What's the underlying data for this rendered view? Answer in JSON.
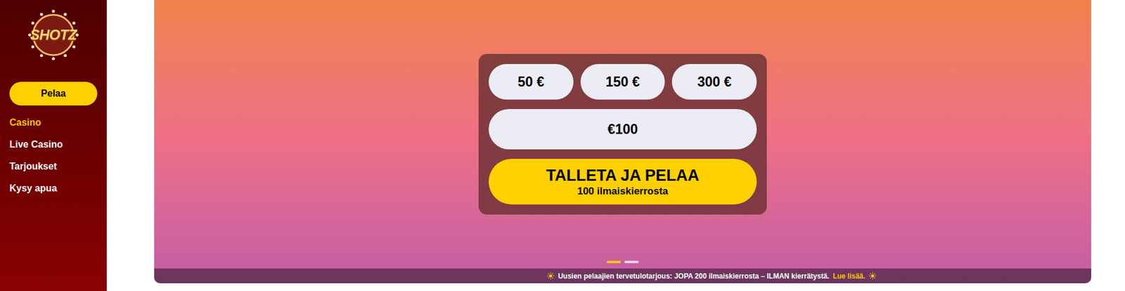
{
  "logo": {
    "text": "SHOTZ"
  },
  "sidebar": {
    "play_button": "Pelaa",
    "items": [
      {
        "label": "Casino",
        "selected": true
      },
      {
        "label": "Live Casino",
        "selected": false
      },
      {
        "label": "Tarjoukset",
        "selected": false
      },
      {
        "label": "Kysy apua",
        "selected": false
      }
    ]
  },
  "deposit": {
    "amounts": [
      {
        "label": "50 €",
        "selected": false
      },
      {
        "label": "150 €",
        "selected": false
      },
      {
        "label": "300 €",
        "selected": false
      }
    ],
    "input_value": "€100",
    "button": {
      "title": "TALLETA JA PELAA",
      "subtitle": "100 ilmaiskierrosta"
    }
  },
  "carousel": {
    "dots": [
      {
        "selected": true
      },
      {
        "selected": false
      }
    ]
  },
  "promo_strip": {
    "text": "Uusien pelaajien tervetulotarjous: JOPA 200 ilmaiskierrosta – ILMAN kierrätystä.",
    "link": "Lue lisää."
  }
}
